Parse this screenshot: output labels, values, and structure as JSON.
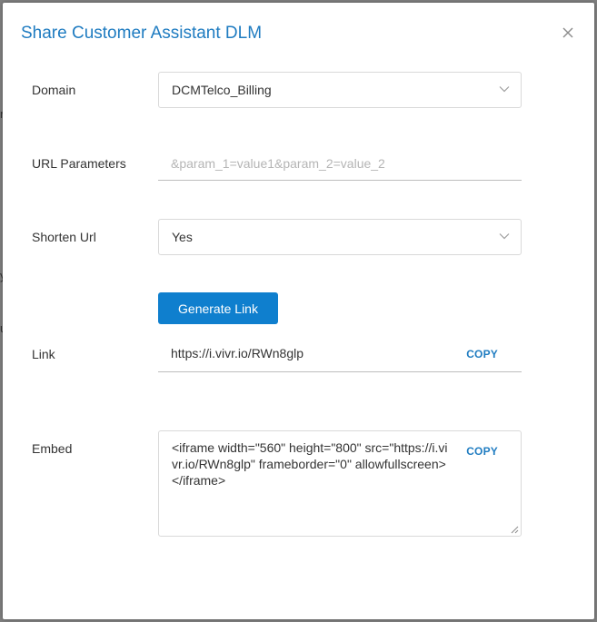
{
  "dialog": {
    "title": "Share Customer Assistant DLM"
  },
  "background_fragments": [
    "r",
    "y",
    "u"
  ],
  "form": {
    "domain": {
      "label": "Domain",
      "value": "DCMTelco_Billing"
    },
    "url_parameters": {
      "label": "URL Parameters",
      "value": "",
      "placeholder": "&param_1=value1&param_2=value_2"
    },
    "shorten_url": {
      "label": "Shorten Url",
      "value": "Yes"
    },
    "generate_button": {
      "label": "Generate Link"
    },
    "link": {
      "label": "Link",
      "value": "https://i.vivr.io/RWn8glp",
      "copy_label": "COPY"
    },
    "embed": {
      "label": "Embed",
      "value": "<iframe width=\"560\" height=\"800\" src=\"https://i.vivr.io/RWn8glp\" frameborder=\"0\" allowfullscreen></iframe>",
      "copy_label": "COPY"
    }
  },
  "colors": {
    "title": "#1f7cc1",
    "primary_button": "#0f7fce",
    "copy_link": "#1f7cc1"
  },
  "icons": {
    "close": "close-icon",
    "dropdown": "chevron-down-icon"
  }
}
